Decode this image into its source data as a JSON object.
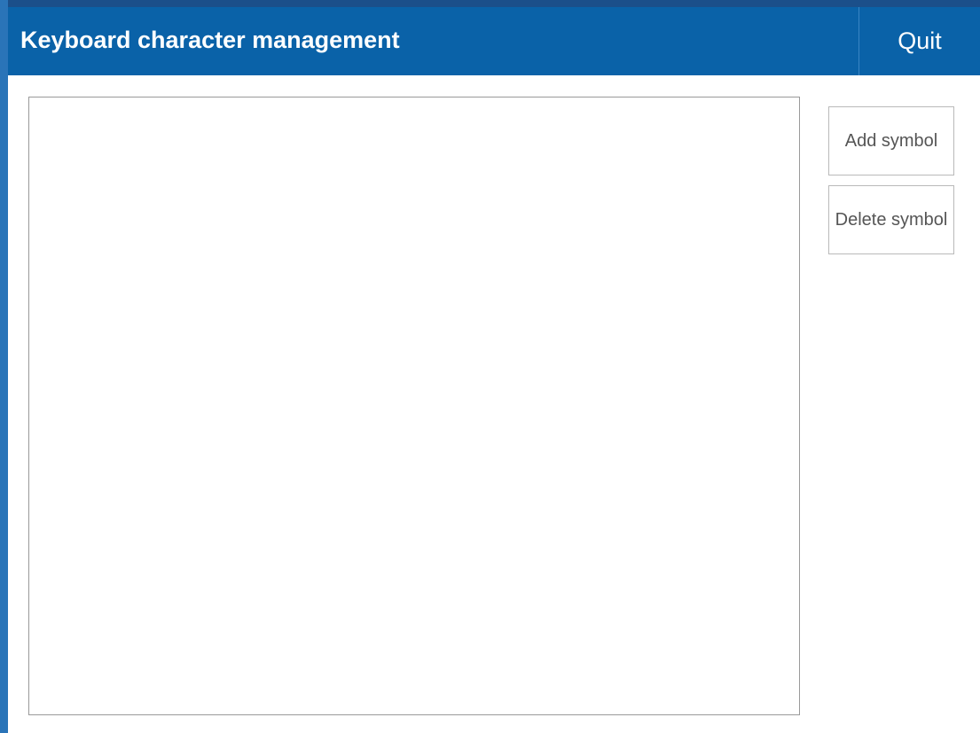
{
  "window": {
    "title": "Keyboard character management",
    "quit_label": "Quit"
  },
  "actions": {
    "add_label": "Add symbol",
    "delete_label": "Delete symbol"
  },
  "symbol_list": {
    "items": []
  },
  "colors": {
    "titlebar": "#0a62a8",
    "background": "#ffffff"
  }
}
